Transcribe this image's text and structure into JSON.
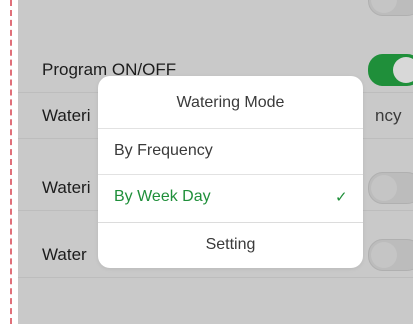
{
  "rows": [
    {
      "label": "Program ON/OFF",
      "toggle_on": true
    },
    {
      "label": "Wateri",
      "right_text": "ncy"
    },
    {
      "label": "Wateri",
      "toggle_on": false
    },
    {
      "label": "Water",
      "toggle_on": false
    }
  ],
  "modal": {
    "title": "Watering Mode",
    "options": [
      {
        "label": "By Frequency",
        "selected": false
      },
      {
        "label": "By Week Day",
        "selected": true
      }
    ],
    "check_glyph": "✓",
    "setting_label": "Setting"
  },
  "colors": {
    "accent": "#1f8f3a",
    "overlay_bg": "#c9c9c9",
    "modal_bg": "#ffffff"
  },
  "icons": {
    "selected_mark": "checkmark-icon"
  }
}
